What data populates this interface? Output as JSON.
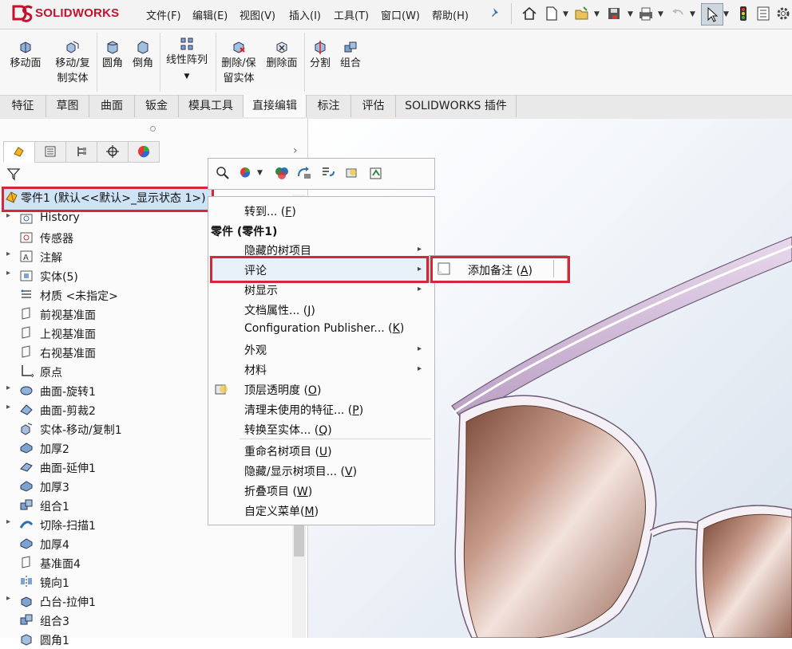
{
  "app": {
    "brand": "SOLIDWORKS",
    "brand_color": "#c8102e",
    "accent": "#d6263b"
  },
  "menu": [
    "文件(F)",
    "编辑(E)",
    "视图(V)",
    "插入(I)",
    "工具(T)",
    "窗口(W)",
    "帮助(H)"
  ],
  "quick_access": [
    "pin-icon",
    "home-icon",
    "new-icon",
    "open-icon",
    "save-icon",
    "print-icon",
    "undo-icon",
    "select-icon",
    "rebuild-icon",
    "options-list-icon",
    "gear-icon"
  ],
  "ribbon": {
    "buttons": [
      {
        "line1": "移动面",
        "line2": ""
      },
      {
        "line1": "移动/复",
        "line2": "制实体"
      },
      {
        "line1": "圆角",
        "line2": ""
      },
      {
        "line1": "倒角",
        "line2": ""
      },
      {
        "line1": "线性阵列",
        "line2": ""
      },
      {
        "line1": "删除/保",
        "line2": "留实体"
      },
      {
        "line1": "删除面",
        "line2": ""
      },
      {
        "line1": "分割",
        "line2": ""
      },
      {
        "line1": "组合",
        "line2": ""
      }
    ]
  },
  "tabs": [
    "特征",
    "草图",
    "曲面",
    "钣金",
    "模具工具",
    "直接编辑",
    "标注",
    "评估",
    "SOLIDWORKS 插件"
  ],
  "active_tab": "直接编辑",
  "tree": {
    "root_label": "零件1 (默认<<默认>_显示状态 1>)",
    "items": [
      {
        "label": "History",
        "expandable": true,
        "icon": "history-folder-icon"
      },
      {
        "label": "传感器",
        "expandable": false,
        "icon": "sensor-icon"
      },
      {
        "label": "注解",
        "expandable": true,
        "icon": "annotation-icon"
      },
      {
        "label": "实体(5)",
        "expandable": true,
        "icon": "solid-bodies-icon"
      },
      {
        "label": "材质 <未指定>",
        "expandable": false,
        "icon": "material-icon"
      },
      {
        "label": "前视基准面",
        "expandable": false,
        "icon": "plane-icon"
      },
      {
        "label": "上视基准面",
        "expandable": false,
        "icon": "plane-icon"
      },
      {
        "label": "右视基准面",
        "expandable": false,
        "icon": "plane-icon"
      },
      {
        "label": "原点",
        "expandable": false,
        "icon": "origin-icon"
      },
      {
        "label": "曲面-旋转1",
        "expandable": true,
        "icon": "surface-revolve-icon"
      },
      {
        "label": "曲面-剪裁2",
        "expandable": true,
        "icon": "surface-trim-icon"
      },
      {
        "label": "实体-移动/复制1",
        "expandable": false,
        "icon": "move-copy-icon"
      },
      {
        "label": "加厚2",
        "expandable": false,
        "icon": "thicken-icon"
      },
      {
        "label": "曲面-延伸1",
        "expandable": false,
        "icon": "surface-extend-icon"
      },
      {
        "label": "加厚3",
        "expandable": false,
        "icon": "thicken-icon"
      },
      {
        "label": "组合1",
        "expandable": false,
        "icon": "combine-icon"
      },
      {
        "label": "切除-扫描1",
        "expandable": true,
        "icon": "cut-sweep-icon"
      },
      {
        "label": "加厚4",
        "expandable": false,
        "icon": "thicken-icon"
      },
      {
        "label": "基准面4",
        "expandable": false,
        "icon": "plane-icon"
      },
      {
        "label": "镜向1",
        "expandable": false,
        "icon": "mirror-icon"
      },
      {
        "label": "凸台-拉伸1",
        "expandable": true,
        "icon": "boss-extrude-icon"
      },
      {
        "label": "组合3",
        "expandable": false,
        "icon": "combine-icon"
      },
      {
        "label": "圆角1",
        "expandable": false,
        "icon": "fillet-icon"
      }
    ]
  },
  "context_menu": {
    "goto": {
      "text": "转到... (",
      "key": "F",
      "end": ")"
    },
    "header": "零件 (零件1)",
    "hidden_tree_items": "隐藏的树项目",
    "comment": "评论",
    "tree_display": "树显示",
    "doc_props": {
      "text": "文档属性... (",
      "key": "J",
      "end": ")"
    },
    "config_publisher": {
      "text": "Configuration Publisher... (",
      "key": "K",
      "end": ")"
    },
    "appearance": "外观",
    "material": "材料",
    "top_transparency": {
      "text": "顶层透明度 (",
      "key": "O",
      "end": ")"
    },
    "clean_unused": {
      "text": "清理未使用的特征... (",
      "key": "P",
      "end": ")"
    },
    "convert_solid": {
      "text": "转换至实体... (",
      "key": "Q",
      "end": ")"
    },
    "rename": {
      "text": "重命名树项目 (",
      "key": "U",
      "end": ")"
    },
    "hide_show": {
      "text": "隐藏/显示树项目... (",
      "key": "V",
      "end": ")"
    },
    "collapse": {
      "text": "折叠项目 (",
      "key": "W",
      "end": ")"
    },
    "customize": {
      "text": "自定义菜单(",
      "key": "M",
      "end": ")"
    }
  },
  "submenu": {
    "text": "添加备注 (",
    "key": "A",
    "end": ")"
  }
}
